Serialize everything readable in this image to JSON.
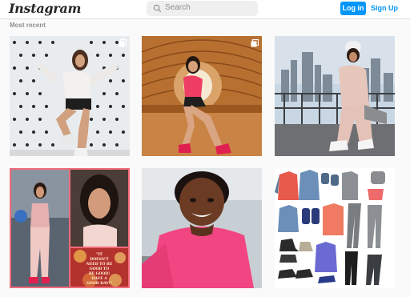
{
  "header": {
    "logo": "Instagram",
    "search_placeholder": "Search",
    "login_label": "Log in",
    "signup_label": "Sign Up"
  },
  "section": {
    "label": "Most recent"
  },
  "posts": [
    {
      "name": "post-1",
      "multi": true
    },
    {
      "name": "post-2",
      "multi": true
    },
    {
      "name": "post-3",
      "multi": false
    },
    {
      "name": "post-4",
      "quote_lines": [
        "\"IT",
        "DOESN'T",
        "NEED TO BE",
        "GOOD TO",
        "BE GOOD!",
        "HAVE A",
        "GOOD DAY!\""
      ]
    },
    {
      "name": "post-5"
    },
    {
      "name": "post-6"
    }
  ],
  "colors": {
    "login_bg": "#0095f6",
    "link": "#0095f6",
    "pink": "#f0457a"
  }
}
